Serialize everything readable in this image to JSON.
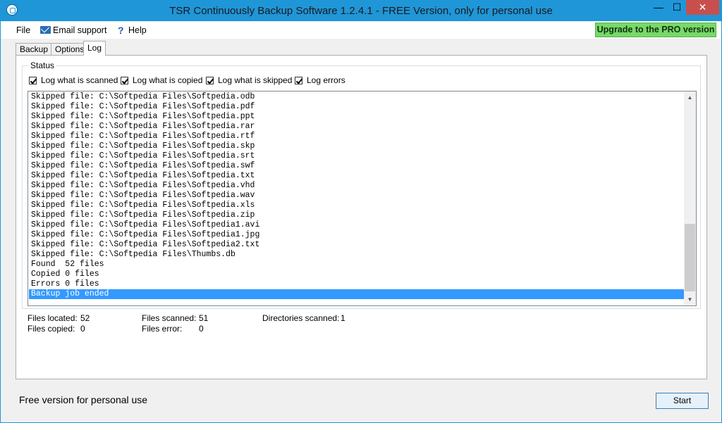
{
  "window": {
    "title": "TSR Continuously Backup Software 1.2.4.1 - FREE Version, only for personal use",
    "minimize_glyph": "—",
    "maximize_glyph": "☐",
    "close_glyph": "✕"
  },
  "menu": {
    "file": "File",
    "email_support": "Email support",
    "help": "Help",
    "help_icon_glyph": "?",
    "upgrade": "Upgrade to the PRO version"
  },
  "tabs": [
    {
      "label": "Backup"
    },
    {
      "label": "Options"
    },
    {
      "label": "Log"
    }
  ],
  "status": {
    "legend": "Status",
    "checkboxes": [
      {
        "label": "Log what is scanned",
        "checked": true
      },
      {
        "label": "Log what is copied",
        "checked": true
      },
      {
        "label": "Log what is skipped",
        "checked": true
      },
      {
        "label": "Log errors",
        "checked": true
      }
    ]
  },
  "log_lines": [
    "Skipped file: C:\\Softpedia Files\\Softpedia.odb",
    "Skipped file: C:\\Softpedia Files\\Softpedia.pdf",
    "Skipped file: C:\\Softpedia Files\\Softpedia.ppt",
    "Skipped file: C:\\Softpedia Files\\Softpedia.rar",
    "Skipped file: C:\\Softpedia Files\\Softpedia.rtf",
    "Skipped file: C:\\Softpedia Files\\Softpedia.skp",
    "Skipped file: C:\\Softpedia Files\\Softpedia.srt",
    "Skipped file: C:\\Softpedia Files\\Softpedia.swf",
    "Skipped file: C:\\Softpedia Files\\Softpedia.txt",
    "Skipped file: C:\\Softpedia Files\\Softpedia.vhd",
    "Skipped file: C:\\Softpedia Files\\Softpedia.wav",
    "Skipped file: C:\\Softpedia Files\\Softpedia.xls",
    "Skipped file: C:\\Softpedia Files\\Softpedia.zip",
    "Skipped file: C:\\Softpedia Files\\Softpedia1.avi",
    "Skipped file: C:\\Softpedia Files\\Softpedia1.jpg",
    "Skipped file: C:\\Softpedia Files\\Softpedia2.txt",
    "Skipped file: C:\\Softpedia Files\\Thumbs.db",
    "Found  52 files",
    "Copied 0 files",
    "Errors 0 files",
    "Backup job ended"
  ],
  "selected_log_index": 20,
  "stats": {
    "files_located_label": "Files located:",
    "files_located": "52",
    "files_scanned_label": "Files scanned:",
    "files_scanned": "51",
    "directories_scanned_label": "Directories scanned:",
    "directories_scanned": "1",
    "files_copied_label": "Files copied:",
    "files_copied": "0",
    "files_error_label": "Files error:",
    "files_error": "0"
  },
  "footer": {
    "text": "Free version for personal use",
    "start_button": "Start"
  },
  "colors": {
    "titlebar": "#1f96d8",
    "upgrade_bg": "#78d86a",
    "selection": "#3399ff",
    "close_button": "#c7504e"
  },
  "icons": {
    "app": "app-icon",
    "email": "mail-icon",
    "help": "help-icon"
  }
}
